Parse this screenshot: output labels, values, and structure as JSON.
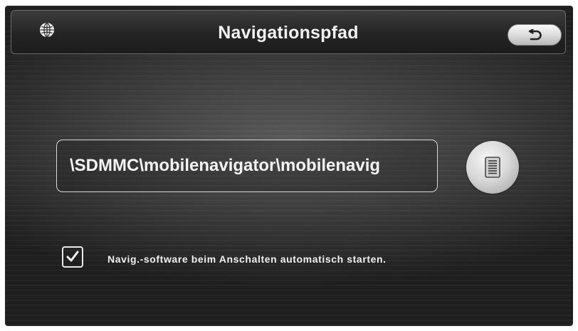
{
  "header": {
    "title": "Navigationspfad",
    "left_icon": "globe-icon",
    "back_icon": "return-arrow-icon"
  },
  "path_field": {
    "value": "\\SDMMC\\mobilenavigator\\mobilenavig"
  },
  "browse_button": {
    "icon": "list-icon"
  },
  "autostart": {
    "checked": true,
    "label": "Navig.-software beim Anschalten automatisch starten."
  }
}
